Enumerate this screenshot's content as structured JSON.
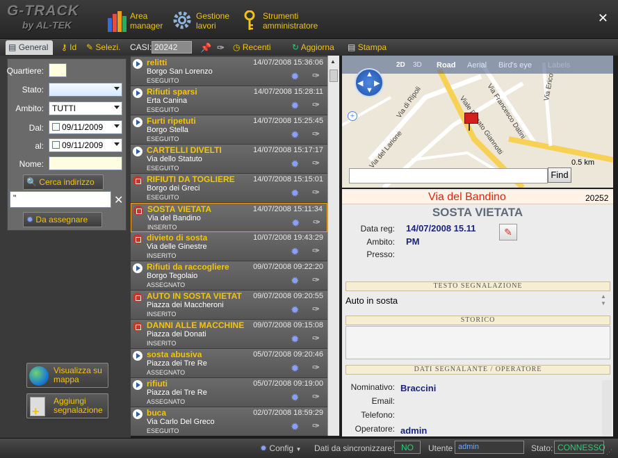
{
  "app": {
    "logo_line1": "G-TRACK",
    "logo_line2": "by AL-TEK"
  },
  "nav": [
    {
      "line1": "Area",
      "line2": "manager"
    },
    {
      "line1": "Gestione",
      "line2": "lavori"
    },
    {
      "line1": "Strumenti",
      "line2": "amministratore"
    }
  ],
  "close_glyph": "✕",
  "toolbar": {
    "tab_general": "General",
    "tab_id": "Id",
    "tab_selezi": "Selezi.",
    "casi_label": "CASI:",
    "casi_value": "20242",
    "recenti": "Recenti",
    "aggiorna": "Aggiorna",
    "stampa": "Stampa"
  },
  "filters": {
    "quartiere_label": "Quartiere:",
    "stato_label": "Stato:",
    "ambito_label": "Ambito:",
    "ambito_value": "TUTTI",
    "dal_label": "Dal:",
    "dal_value": "09/11/2009",
    "al_label": "al:",
    "al_value": "09/11/2009",
    "nome_label": "Nome:",
    "cerca_indirizzo": "Cerca indirizzo",
    "address_value": "\"",
    "da_assegnare": "Da assegnare",
    "visualizza_mappa": "Visualizza su mappa",
    "aggiungi_segnalazione": "Aggiungi segnalazione"
  },
  "list": [
    {
      "title": "relitti",
      "date": "14/07/2008 15:36:06",
      "address": "Borgo San Lorenzo",
      "status": "ESEGUITO",
      "icon": "play"
    },
    {
      "title": "Rifiuti sparsi",
      "date": "14/07/2008 15:28:11",
      "address": "Erta Canina",
      "status": "ESEGUITO",
      "icon": "play"
    },
    {
      "title": "Furti ripetuti",
      "date": "14/07/2008 15:25:45",
      "address": "Borgo Stella",
      "status": "ESEGUITO",
      "icon": "play"
    },
    {
      "title": "CARTELLI DIVELTI",
      "date": "14/07/2008 15:17:17",
      "address": "Via dello Statuto",
      "status": "ESEGUITO",
      "icon": "play"
    },
    {
      "title": "RIFIUTI DA TOGLIERE",
      "date": "14/07/2008 15:15:01",
      "address": "Borgo dei Greci",
      "status": "ESEGUITO",
      "icon": "stop"
    },
    {
      "title": "SOSTA VIETATA",
      "date": "14/07/2008 15:11:34",
      "address": "Via del Bandino",
      "status": "INSERITO",
      "icon": "stop",
      "selected": true
    },
    {
      "title": "divieto di sosta",
      "date": "10/07/2008 19:43:29",
      "address": "Via delle Ginestre",
      "status": "INSERITO",
      "icon": "stop"
    },
    {
      "title": "Rifiuti da raccogliere",
      "date": "09/07/2008 09:22:20",
      "address": "Borgo Tegolaio",
      "status": "ASSEGNATO",
      "icon": "play"
    },
    {
      "title": "AUTO IN SOSTA VIETAT",
      "date": "09/07/2008 09:20:55",
      "address": "Piazza dei Maccheroni",
      "status": "INSERITO",
      "icon": "stop"
    },
    {
      "title": "DANNI ALLE MACCHINE",
      "date": "09/07/2008 09:15:08",
      "address": "Piazza dei Donati",
      "status": "INSERITO",
      "icon": "stop"
    },
    {
      "title": "sosta abusiva",
      "date": "05/07/2008 09:20:46",
      "address": "Piazza dei Tre Re",
      "status": "ASSEGNATO",
      "icon": "play"
    },
    {
      "title": "rifiuti",
      "date": "05/07/2008 09:19:00",
      "address": "Piazza dei Tre Re",
      "status": "ASSEGNATO",
      "icon": "play"
    },
    {
      "title": "buca",
      "date": "02/07/2008 18:59:29",
      "address": "Via Carlo Del Greco",
      "status": "ESEGUITO",
      "icon": "play"
    }
  ],
  "map": {
    "mode_2d": "2D",
    "mode_3d": "3D",
    "road": "Road",
    "aerial": "Aerial",
    "birds_eye": "Bird's eye",
    "labels": "Labels",
    "scale": "0.5 km",
    "find": "Find",
    "streets": [
      "Via di Ripoli",
      "Viale Donato Giannotti",
      "Via Francesco Datini",
      "Via del Larione",
      "Via Erico"
    ]
  },
  "detail": {
    "address": "Via del Bandino",
    "id": "20252",
    "title": "SOSTA VIETATA",
    "data_reg_label": "Data reg:",
    "data_reg_value": "14/07/2008 15.11",
    "ambito_label": "Ambito:",
    "ambito_value": "PM",
    "presso_label": "Presso:",
    "testo_header": "TESTO SEGNALAZIONE",
    "testo_value": "Auto in sosta",
    "storico_header": "STORICO",
    "dati_header": "DATI SEGNALANTE / OPERATORE",
    "nominativo_label": "Nominativo:",
    "nominativo_value": "Braccini",
    "email_label": "Email:",
    "telefono_label": "Telefono:",
    "operatore_label": "Operatore:",
    "operatore_value": "admin"
  },
  "status": {
    "config": "Config",
    "sync_label": "Dati da sincronizzare:",
    "sync_value": "NO",
    "utente_label": "Utente",
    "utente_value": "admin",
    "stato_label": "Stato:",
    "stato_value": "CONNESSO"
  }
}
